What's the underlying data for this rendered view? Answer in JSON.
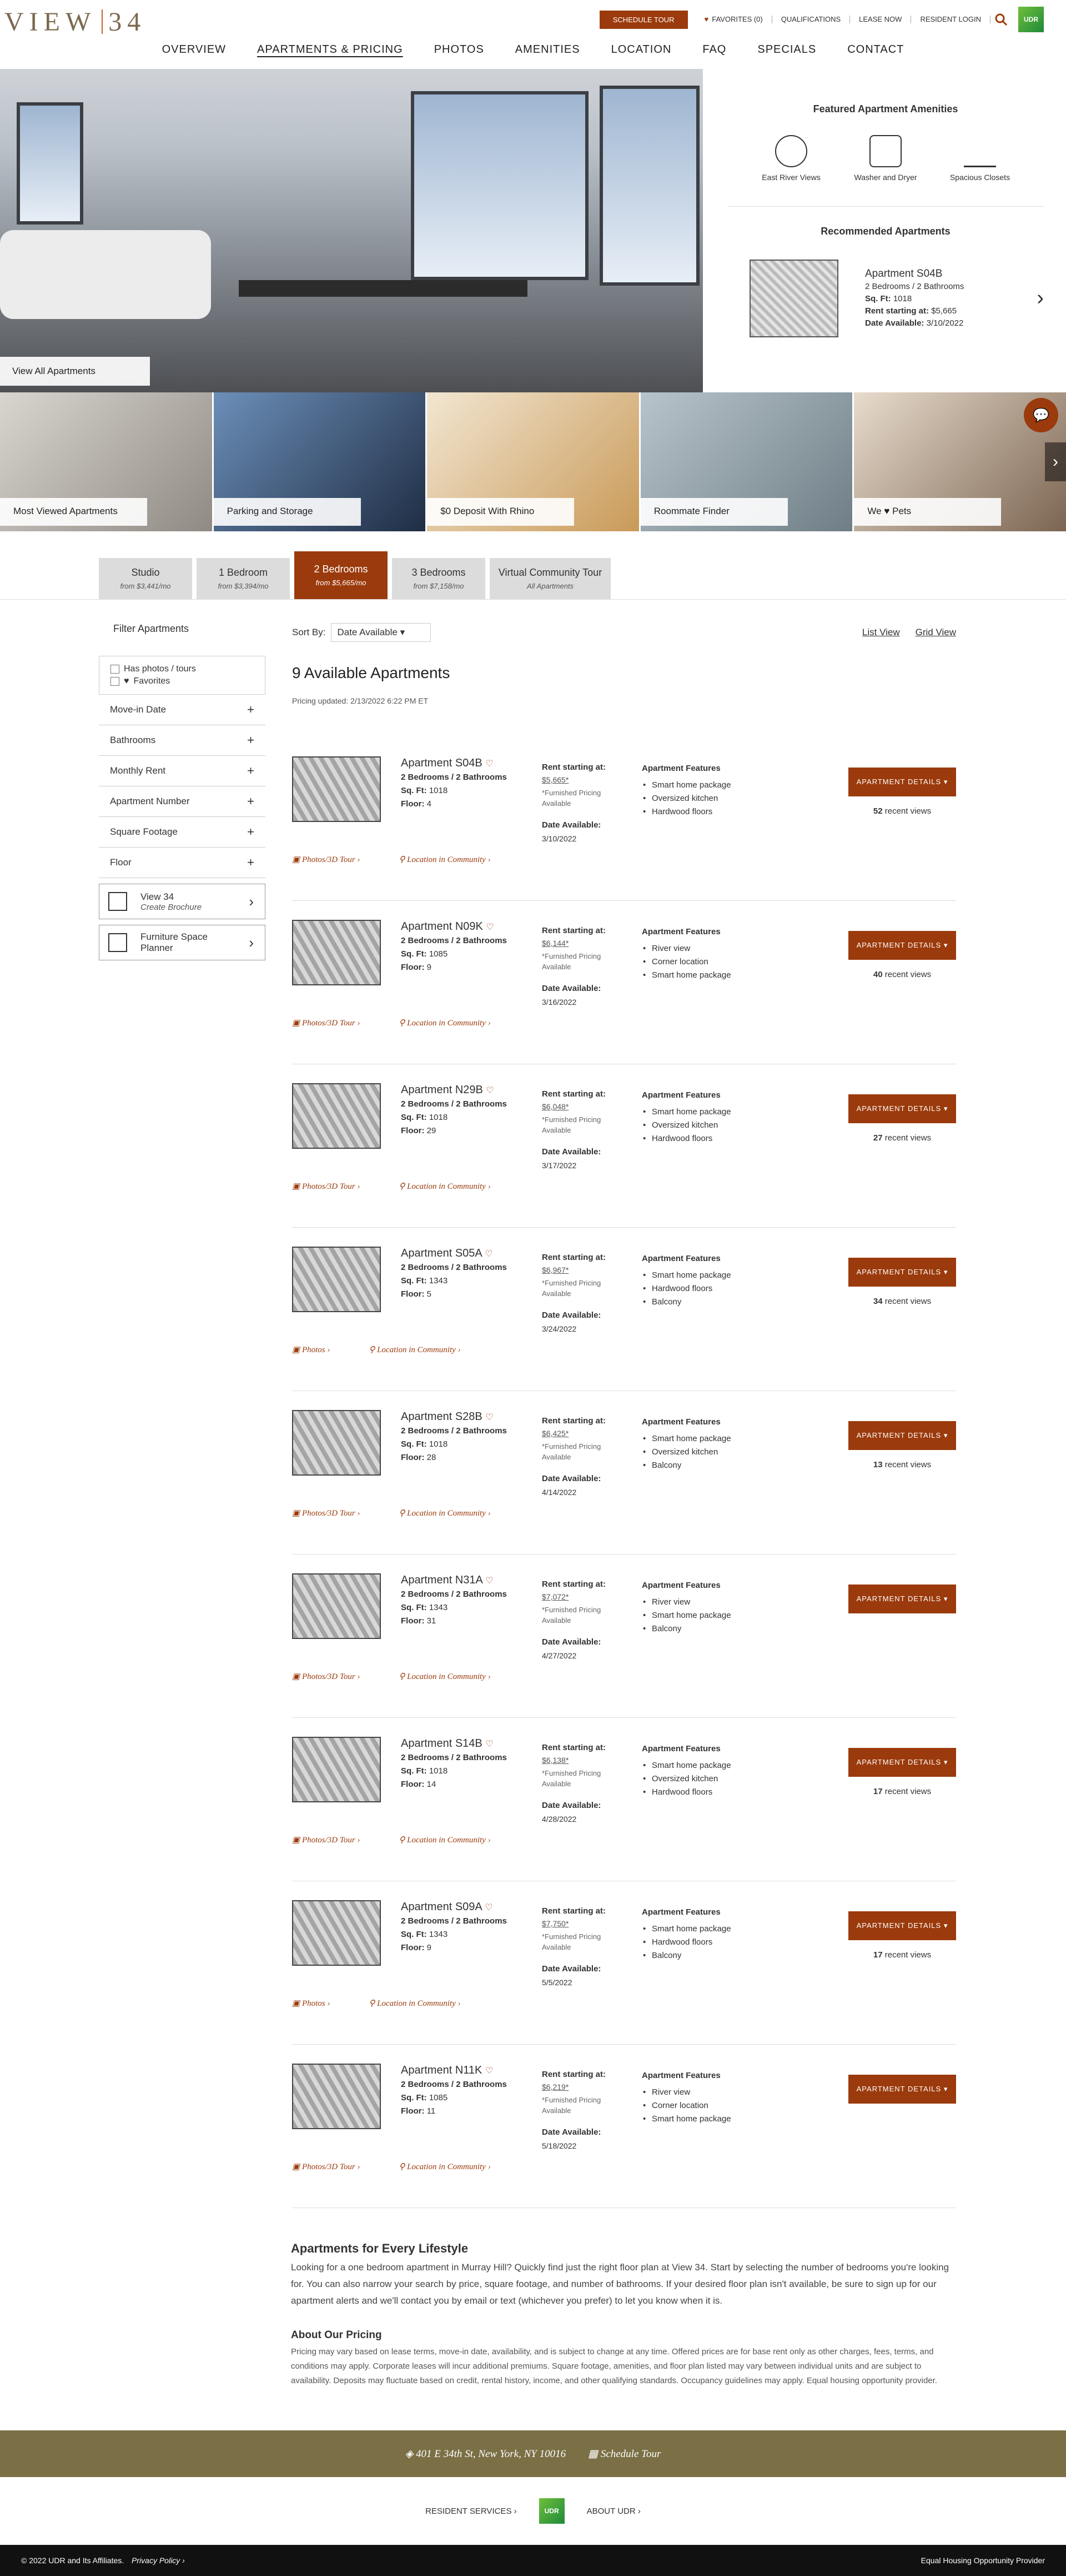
{
  "brand": {
    "logo_left": "VIEW",
    "logo_right": "34",
    "udr": "UDR"
  },
  "util": {
    "schedule": "SCHEDULE TOUR",
    "favorites": "FAVORITES (0)",
    "qualifications": "QUALIFICATIONS",
    "lease_now": "LEASE NOW",
    "resident_login": "RESIDENT LOGIN"
  },
  "nav": [
    "OVERVIEW",
    "APARTMENTS & PRICING",
    "PHOTOS",
    "AMENITIES",
    "LOCATION",
    "FAQ",
    "SPECIALS",
    "CONTACT"
  ],
  "hero": {
    "view_all": "View All Apartments"
  },
  "featured": {
    "title": "Featured Apartment Amenities",
    "items": [
      "East River Views",
      "Washer and Dryer",
      "Spacious Closets"
    ]
  },
  "recommended": {
    "title": "Recommended Apartments",
    "name": "Apartment S04B",
    "beds": "2 Bedrooms / 2 Bathrooms",
    "sqft_label": "Sq. Ft:",
    "sqft": "1018",
    "rent_label": "Rent starting at:",
    "rent": "$5,665",
    "date_label": "Date Available:",
    "date": "3/10/2022"
  },
  "tiles": [
    "Most Viewed Apartments",
    "Parking and Storage",
    "$0 Deposit With Rhino",
    "Roommate Finder",
    "We ♥ Pets"
  ],
  "tabs": [
    {
      "label": "Studio",
      "sub": "from $3,441/mo"
    },
    {
      "label": "1 Bedroom",
      "sub": "from $3,394/mo"
    },
    {
      "label": "2 Bedrooms",
      "sub": "from $5,665/mo"
    },
    {
      "label": "3 Bedrooms",
      "sub": "from $7,158/mo"
    },
    {
      "label": "Virtual Community Tour",
      "sub": "All Apartments"
    }
  ],
  "filters": {
    "title": "Filter Apartments",
    "cb1": "Has photos / tours",
    "cb2": "Favorites",
    "acc": [
      "Move-in Date",
      "Bathrooms",
      "Monthly Rent",
      "Apartment Number",
      "Square Footage",
      "Floor"
    ],
    "brochure_t": "View 34",
    "brochure_s": "Create Brochure",
    "planner_t": "Furniture Space",
    "planner_s": "Planner"
  },
  "sort": {
    "label": "Sort By:",
    "value": "Date Available",
    "list": "List View",
    "grid": "Grid View"
  },
  "results": {
    "title": "9 Available Apartments",
    "updated": "Pricing updated: 2/13/2022 6:22 PM ET",
    "sqft": "Sq. Ft:",
    "floor": "Floor:",
    "rent_label": "Rent starting at:",
    "furnished": "*Furnished Pricing Available",
    "date_label": "Date Available:",
    "features_label": "Apartment Features",
    "details": "APARTMENT DETAILS ▾",
    "views": "recent views",
    "loc": "Location in Community ›"
  },
  "apartments": [
    {
      "name": "Apartment S04B",
      "beds": "2 Bedrooms / 2 Bathrooms",
      "sqft": "1018",
      "floor": "4",
      "rent": "$5,665*",
      "date": "3/10/2022",
      "f": [
        "Smart home package",
        "Oversized kitchen",
        "Hardwood floors"
      ],
      "views": "52",
      "photo": "Photos/3D Tour ›"
    },
    {
      "name": "Apartment N09K",
      "beds": "2 Bedrooms / 2 Bathrooms",
      "sqft": "1085",
      "floor": "9",
      "rent": "$6,144*",
      "date": "3/16/2022",
      "f": [
        "River view",
        "Corner location",
        "Smart home package"
      ],
      "views": "40",
      "photo": "Photos/3D Tour ›"
    },
    {
      "name": "Apartment N29B",
      "beds": "2 Bedrooms / 2 Bathrooms",
      "sqft": "1018",
      "floor": "29",
      "rent": "$6,048*",
      "date": "3/17/2022",
      "f": [
        "Smart home package",
        "Oversized kitchen",
        "Hardwood floors"
      ],
      "views": "27",
      "photo": "Photos/3D Tour ›"
    },
    {
      "name": "Apartment S05A",
      "beds": "2 Bedrooms / 2 Bathrooms",
      "sqft": "1343",
      "floor": "5",
      "rent": "$6,967*",
      "date": "3/24/2022",
      "f": [
        "Smart home package",
        "Hardwood floors",
        "Balcony"
      ],
      "views": "34",
      "photo": "Photos ›"
    },
    {
      "name": "Apartment S28B",
      "beds": "2 Bedrooms / 2 Bathrooms",
      "sqft": "1018",
      "floor": "28",
      "rent": "$6,425*",
      "date": "4/14/2022",
      "f": [
        "Smart home package",
        "Oversized kitchen",
        "Balcony"
      ],
      "views": "13",
      "photo": "Photos/3D Tour ›"
    },
    {
      "name": "Apartment N31A",
      "beds": "2 Bedrooms / 2 Bathrooms",
      "sqft": "1343",
      "floor": "31",
      "rent": "$7,072*",
      "date": "4/27/2022",
      "f": [
        "River view",
        "Smart home package",
        "Balcony"
      ],
      "views": "",
      "photo": "Photos/3D Tour ›"
    },
    {
      "name": "Apartment S14B",
      "beds": "2 Bedrooms / 2 Bathrooms",
      "sqft": "1018",
      "floor": "14",
      "rent": "$6,138*",
      "date": "4/28/2022",
      "f": [
        "Smart home package",
        "Oversized kitchen",
        "Hardwood floors"
      ],
      "views": "17",
      "photo": "Photos/3D Tour ›"
    },
    {
      "name": "Apartment S09A",
      "beds": "2 Bedrooms / 2 Bathrooms",
      "sqft": "1343",
      "floor": "9",
      "rent": "$7,750*",
      "date": "5/5/2022",
      "f": [
        "Smart home package",
        "Hardwood floors",
        "Balcony"
      ],
      "views": "17",
      "photo": "Photos ›"
    },
    {
      "name": "Apartment N11K",
      "beds": "2 Bedrooms / 2 Bathrooms",
      "sqft": "1085",
      "floor": "11",
      "rent": "$6,219*",
      "date": "5/18/2022",
      "f": [
        "River view",
        "Corner location",
        "Smart home package"
      ],
      "views": "",
      "photo": "Photos/3D Tour ›"
    }
  ],
  "lifestyle": {
    "title": "Apartments for Every Lifestyle",
    "body": "Looking for a one bedroom apartment in Murray Hill? Quickly find just the right floor plan at View 34. Start by selecting the number of bedrooms you're looking for. You can also narrow your search by price, square footage, and number of bathrooms. If your desired floor plan isn't available, be sure to sign up for our apartment alerts and we'll contact you by email or text (whichever you prefer) to let you know when it is.",
    "pricing_title": "About Our Pricing",
    "pricing_body": "Pricing may vary based on lease terms, move-in date, availability, and is subject to change at any time. Offered prices are for base rent only as other charges, fees, terms, and conditions may apply. Corporate leases will incur additional premiums. Square footage, amenities, and floor plan listed may vary between individual units and are subject to availability. Deposits may fluctuate based on credit, rental history, income, and other qualifying standards. Occupancy guidelines may apply. Equal housing opportunity provider."
  },
  "footer": {
    "address": "401 E 34th St, New York, NY 10016",
    "schedule": "Schedule Tour",
    "resident": "RESIDENT SERVICES ›",
    "about": "ABOUT UDR ›",
    "copyright": "© 2022 UDR and Its Affiliates.",
    "privacy": "Privacy Policy ›",
    "equal": "Equal Housing Opportunity Provider"
  }
}
